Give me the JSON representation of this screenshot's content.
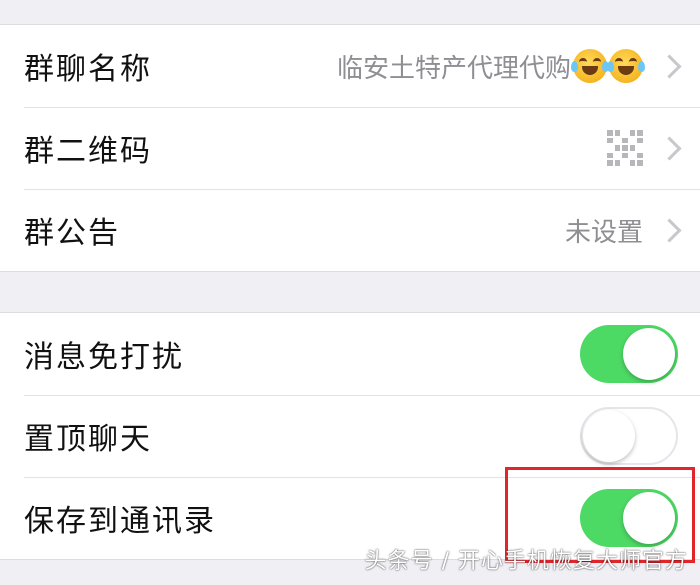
{
  "group_info": {
    "name_label": "群聊名称",
    "name_value": "临安土特产代理代购",
    "name_emoji": "face-with-tears-of-joy",
    "qrcode_label": "群二维码",
    "notice_label": "群公告",
    "notice_value": "未设置"
  },
  "settings": {
    "mute": {
      "label": "消息免打扰",
      "on": true
    },
    "pin": {
      "label": "置顶聊天",
      "on": false
    },
    "save_contacts": {
      "label": "保存到通讯录",
      "on": true
    }
  },
  "colors": {
    "toggle_on": "#4cd964",
    "highlight": "#e0252b"
  },
  "watermark": "头条号 / 开心手机恢复大师官方"
}
